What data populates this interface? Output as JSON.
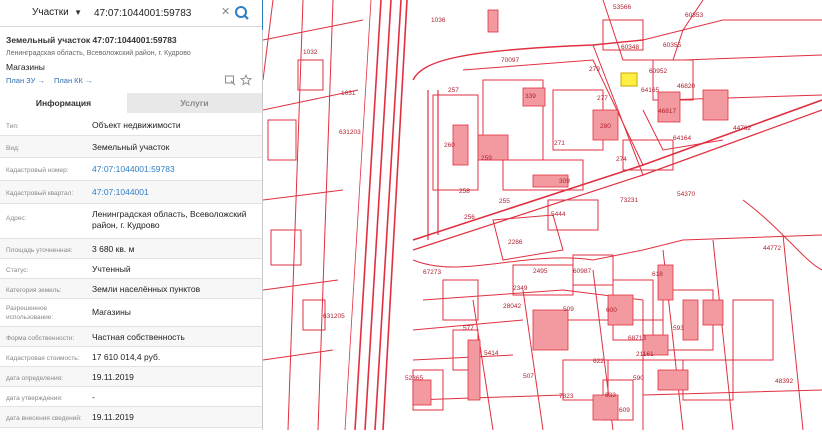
{
  "search": {
    "layer": "Участки",
    "query": "47:07:1044001:59783"
  },
  "object": {
    "title": "Земельный участок 47:07:1044001:59783",
    "address": "Ленинградская область, Всеволожский район, г. Кудрово",
    "usage": "Магазины",
    "plan_zu": "План ЗУ →",
    "plan_kk": "План КК →"
  },
  "tabs": {
    "info": "Информация",
    "services": "Услуги"
  },
  "rows": [
    {
      "label": "Тип:",
      "value": "Объект недвижимости"
    },
    {
      "label": "Вид:",
      "value": "Земельный участок"
    },
    {
      "label": "Кадастровый номер:",
      "value": "47:07:1044001:59783"
    },
    {
      "label": "Кадастровый квартал:",
      "value": "47:07:1044001"
    },
    {
      "label": "Адрес:",
      "value": "Ленинградская область, Всеволожский район, г. Кудрово"
    },
    {
      "label": "Площадь уточненная:",
      "value": "3 680 кв. м"
    },
    {
      "label": "Статус:",
      "value": "Учтенный"
    },
    {
      "label": "Категория земель:",
      "value": "Земли населённых пунктов"
    },
    {
      "label": "Разрешенное использование:",
      "value": "Магазины"
    },
    {
      "label": "Форма собственности:",
      "value": "Частная собственность"
    },
    {
      "label": "Кадастровая стоимость:",
      "value": "17 610 014,4 руб."
    },
    {
      "label": "дата определения:",
      "value": "19.11.2019"
    },
    {
      "label": "дата утверждения:",
      "value": "-"
    },
    {
      "label": "дата внесения сведений:",
      "value": "19.11.2019"
    }
  ],
  "map": {
    "labels": {
      "l1": "53566",
      "l2": "60353",
      "l3": "60348",
      "l4": "60355",
      "l5": "60952",
      "l6": "46820",
      "l7": "64165",
      "l8": "46817",
      "l9": "64164",
      "l10": "44762",
      "l11": "70097",
      "l12": "279",
      "l13": "277",
      "l14": "339",
      "l15": "257",
      "l16": "260",
      "l17": "259",
      "l18": "271",
      "l19": "280",
      "l20": "274",
      "l21": "309",
      "l22": "54370",
      "l23": "73231",
      "l24": "258",
      "l25": "255",
      "l26": "256",
      "l27": "5444",
      "l28": "2286",
      "l29": "631203",
      "l30": "67273",
      "l31": "2495",
      "l32": "60987",
      "l33": "618",
      "l34": "28042",
      "l35": "509",
      "l36": "600",
      "l37": "68713",
      "l38": "593",
      "l39": "21161",
      "l40": "622",
      "l41": "590",
      "l42": "5414",
      "l43": "633",
      "l44": "609",
      "l45": "48392",
      "l46": "631205",
      "l47": "1036",
      "l48": "1031",
      "l49": "1032",
      "l50": "44772",
      "l51": "2349",
      "l52": "507",
      "l53": "7823",
      "l54": "52365",
      "l55": "577"
    }
  },
  "colors": {
    "accent": "#2f7ec3",
    "cadastre_line": "#e03040",
    "cadastre_fill": "#f29aa0",
    "selected_parcel": "#ffee44"
  }
}
